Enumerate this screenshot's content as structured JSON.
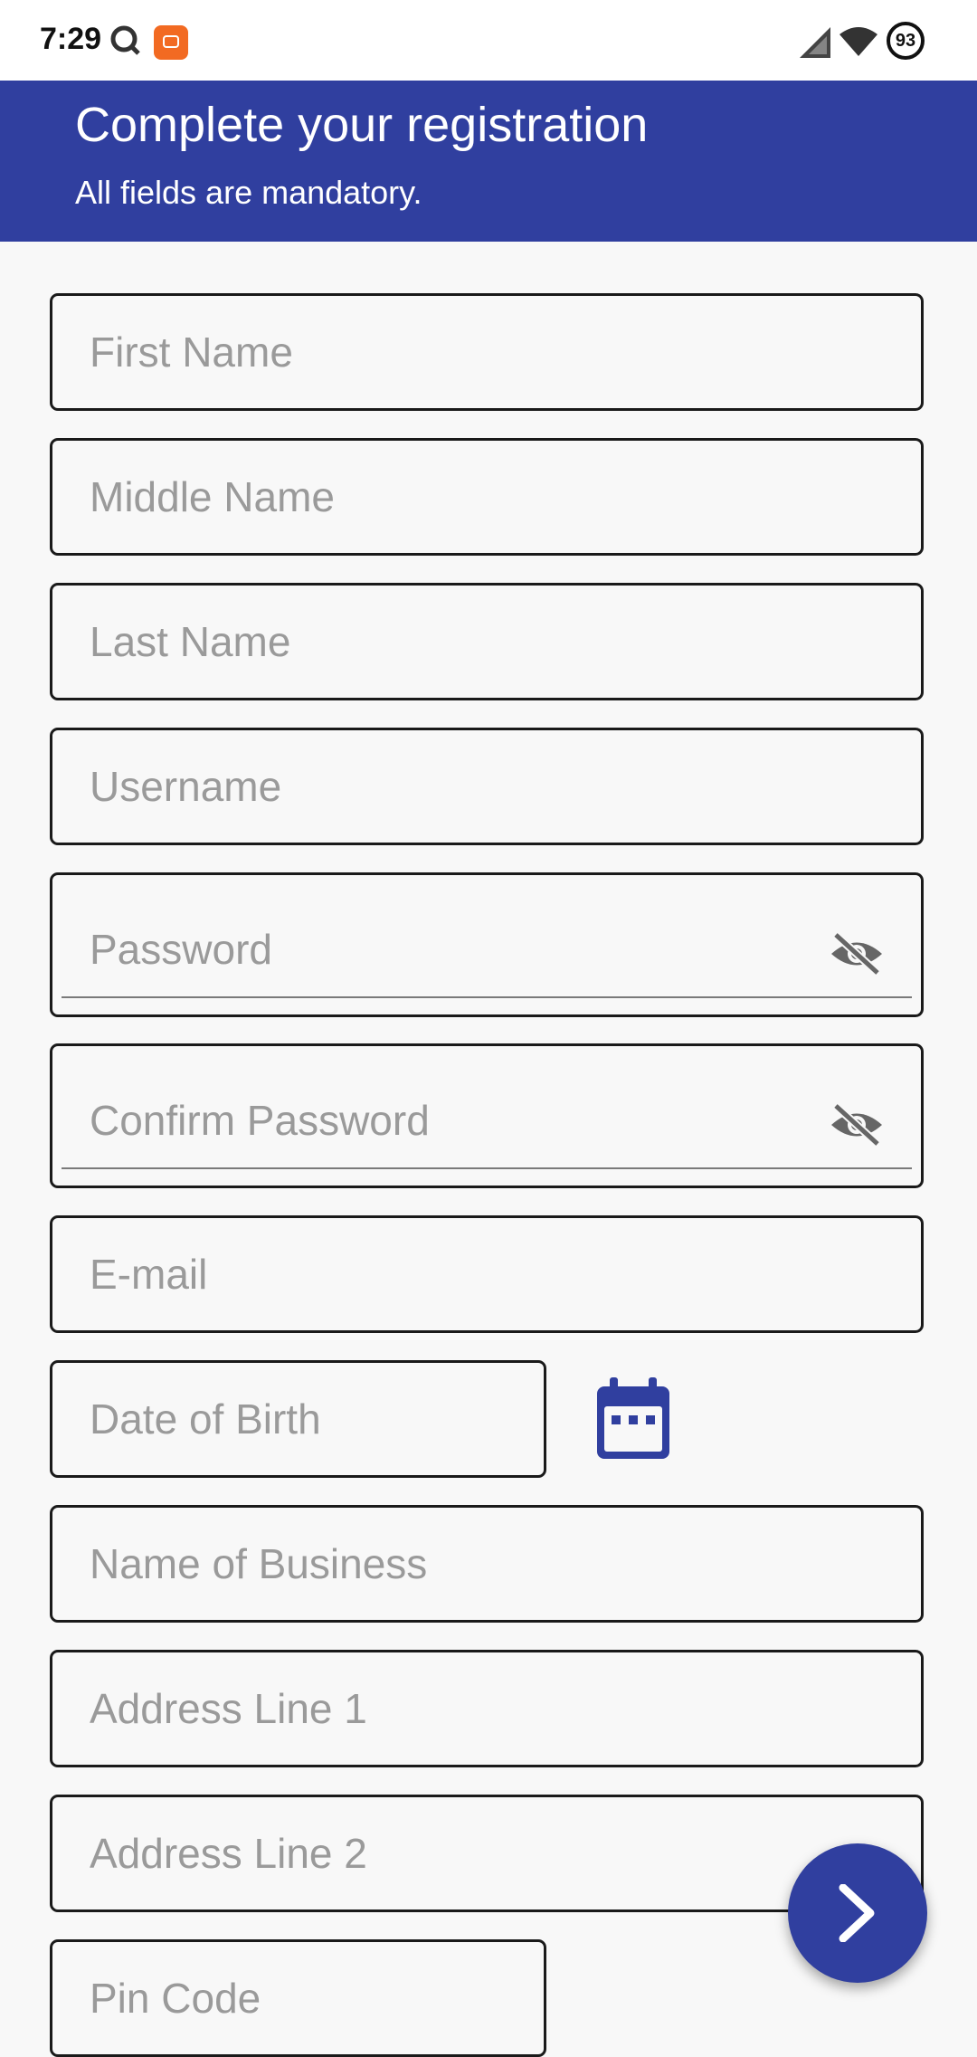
{
  "status_bar": {
    "time": "7:29",
    "battery": "93",
    "icons": [
      "q-icon",
      "mi-app-icon",
      "cell-signal-icon",
      "wifi-icon",
      "battery-icon"
    ]
  },
  "header": {
    "title": "Complete your registration",
    "subtitle": "All fields are mandatory."
  },
  "form": {
    "first_name": "First Name",
    "middle_name": "Middle Name",
    "last_name": "Last Name",
    "username": "Username",
    "password": "Password",
    "confirm_password": "Confirm Password",
    "email": "E-mail",
    "dob": "Date of Birth",
    "business_name": "Name of Business",
    "address1": "Address Line 1",
    "address2": "Address Line 2",
    "pin_code": "Pin Code"
  },
  "colors": {
    "primary": "#303f9f",
    "border": "#1a1a1a",
    "placeholder": "#9a9a9a",
    "background": "#f8f8f8"
  }
}
